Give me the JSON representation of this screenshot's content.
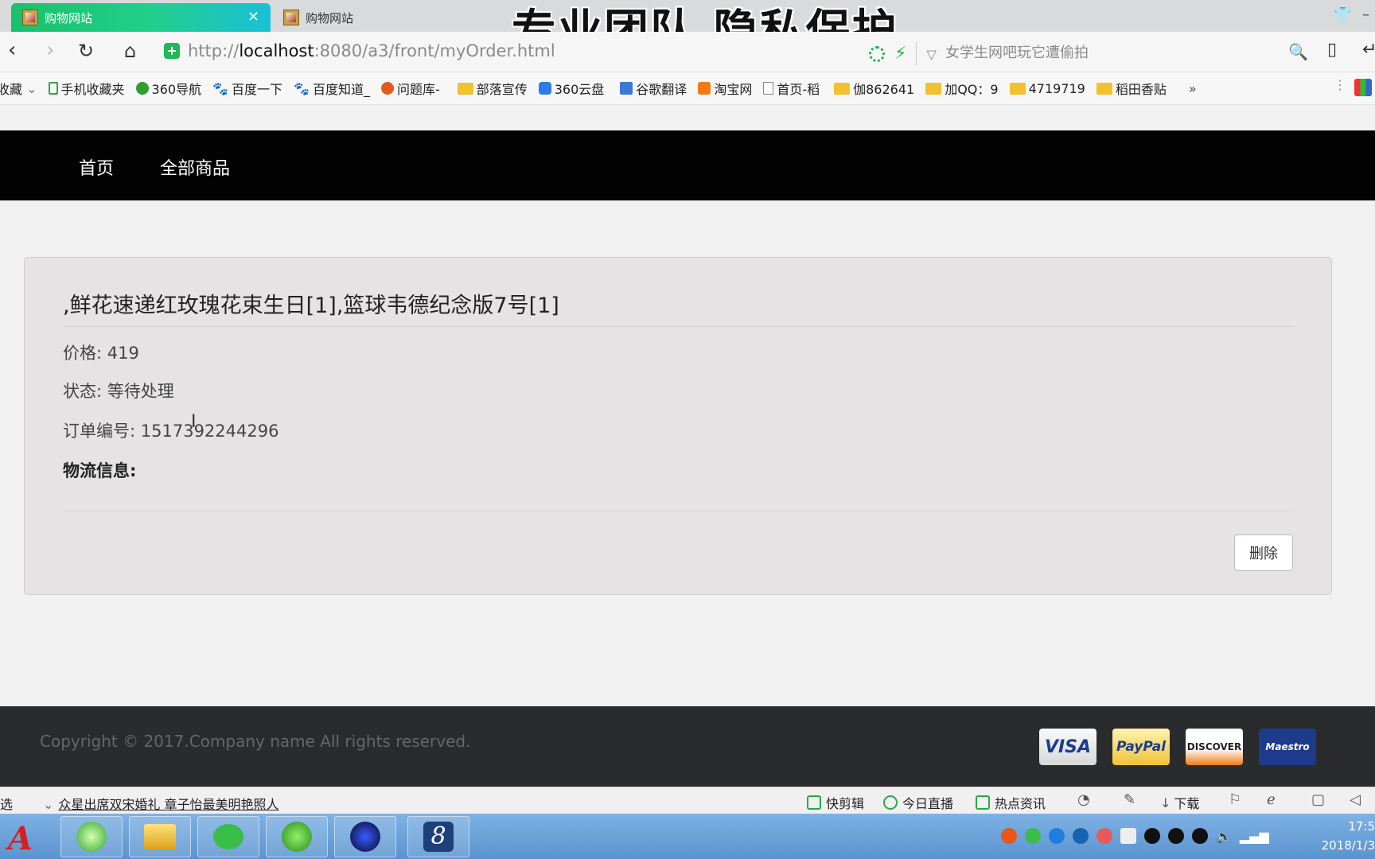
{
  "browser": {
    "tabs": [
      {
        "title": "购物网站",
        "active": true
      },
      {
        "title": "购物网站",
        "active": false
      }
    ],
    "overlay_caption": "专业团队 隐私保护",
    "url_proto": "http://",
    "url_host": "localhost",
    "url_rest": ":8080/a3/front/myOrder.html",
    "search_placeholder": "女学生网吧玩它遭偷拍",
    "bookmarks": [
      {
        "label": "收藏",
        "icon": "star-icon"
      },
      {
        "label": "手机收藏夹",
        "icon": "phone-icon"
      },
      {
        "label": "360导航",
        "icon": "nav360-icon"
      },
      {
        "label": "百度一下",
        "icon": "paw-icon"
      },
      {
        "label": "百度知道_",
        "icon": "paw-icon"
      },
      {
        "label": "问题库-",
        "icon": "s-icon"
      },
      {
        "label": "部落宣传",
        "icon": "folder-icon"
      },
      {
        "label": "360云盘",
        "icon": "cloud-icon"
      },
      {
        "label": "谷歌翻译",
        "icon": "translate-icon"
      },
      {
        "label": "淘宝网",
        "icon": "taobao-icon"
      },
      {
        "label": "首页-稻",
        "icon": "page-icon"
      },
      {
        "label": "伽862641",
        "icon": "folder-icon"
      },
      {
        "label": "加QQ：9",
        "icon": "folder-icon"
      },
      {
        "label": "4719719",
        "icon": "folder-icon"
      },
      {
        "label": "稻田香贴",
        "icon": "folder-icon"
      }
    ],
    "more": "»"
  },
  "site": {
    "nav": [
      "首页",
      "全部商品"
    ]
  },
  "order": {
    "title": ",鲜花速递红玫瑰花束生日[1],篮球韦德纪念版7号[1]",
    "price_label": "价格:",
    "price": "419",
    "status_label": "状态:",
    "status": "等待处理",
    "order_no_label": "订单编号:",
    "order_no": "1517392244296",
    "logistics_label": "物流信息:",
    "delete_label": "删除"
  },
  "footer": {
    "copyright": "Copyright © 2017.Company name All rights reserved.",
    "cards": [
      "VISA",
      "PayPal",
      "DISCOVER",
      "Maestro"
    ]
  },
  "statusbar": {
    "left": "选",
    "news": "众星出席双宋婚礼 章子怡最美明艳照人",
    "items": [
      "快剪辑",
      "今日直播",
      "热点资讯",
      "下载"
    ]
  },
  "taskbar": {
    "time": "17:5",
    "date": "2018/1/3"
  }
}
